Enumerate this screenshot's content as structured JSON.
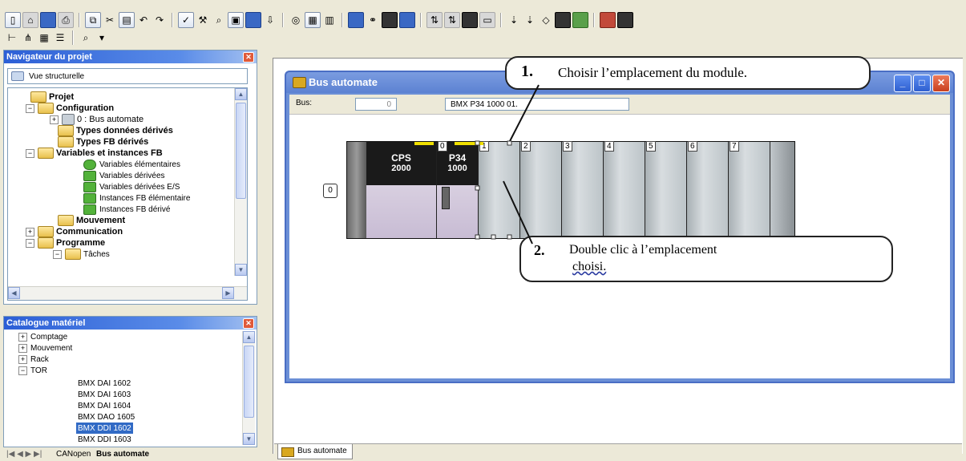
{
  "toolbar": {
    "row1": [
      "new-icon",
      "open-icon",
      "save-icon",
      "print-icon",
      "copy-icon",
      "cut-icon",
      "paste-icon",
      "undo-icon",
      "redo-icon",
      "check-icon",
      "build-icon",
      "search-icon",
      "rebuild-icon",
      "connect-icon",
      "download-icon",
      "animation-icon",
      "library-icon",
      "table-icon",
      "binoculars-icon",
      "screen-icon",
      "monitor-icon",
      "io-icon",
      "io2-icon",
      "rack-icon",
      "module-icon",
      "breakpoint-icon",
      "step-icon",
      "watch-icon",
      "memory-icon",
      "network-icon",
      "window-icon",
      "window2-icon"
    ],
    "row2": [
      "tree-icon",
      "hierarchy-icon",
      "grid-icon",
      "list-icon",
      "zoom-icon",
      "dropdown-icon"
    ]
  },
  "project_nav": {
    "title": "Navigateur du projet",
    "view_label": "Vue structurelle",
    "items": [
      {
        "label": "Projet",
        "bold": true
      },
      {
        "label": "Configuration",
        "bold": true
      },
      {
        "label": "0 : Bus automate",
        "bold": false
      },
      {
        "label": "Types données dérivés",
        "bold": true
      },
      {
        "label": "Types FB dérivés",
        "bold": true
      },
      {
        "label": "Variables et instances FB",
        "bold": true
      },
      {
        "label": "Variables élémentaires",
        "bold": false
      },
      {
        "label": "Variables dérivées",
        "bold": false
      },
      {
        "label": "Variables dérivées E/S",
        "bold": false
      },
      {
        "label": "Instances FB élémentaire",
        "bold": false
      },
      {
        "label": "Instances FB dérivé",
        "bold": false
      },
      {
        "label": "Mouvement",
        "bold": true
      },
      {
        "label": "Communication",
        "bold": true
      },
      {
        "label": "Programme",
        "bold": true
      },
      {
        "label": "Tâches",
        "bold": false
      }
    ]
  },
  "catalog": {
    "title": "Catalogue matériel",
    "items": [
      "Comptage",
      "Mouvement",
      "Rack",
      "TOR",
      "BMX DAI 1602",
      "BMX DAI 1603",
      "BMX DAI 1604",
      "BMX DAO 1605",
      "BMX DDI 1602",
      "BMX DDI 1603"
    ],
    "selected": "BMX DDI 1602"
  },
  "left_tabs": {
    "tab1": "CANopen",
    "tab2": "Bus automate"
  },
  "bus_window": {
    "title": "Bus automate",
    "bus_label": "Bus:",
    "bus_value": "0",
    "cpu_value": "BMX P34 1000  01.",
    "rack_index": "0",
    "modules": [
      {
        "slot": "",
        "name": "CPS",
        "ref": "2000"
      },
      {
        "slot": "0",
        "name": "P34",
        "ref": "1000"
      }
    ],
    "empty_slots": [
      "1",
      "2",
      "3",
      "4",
      "5",
      "6",
      "7"
    ]
  },
  "callouts": {
    "step1_num": "1.",
    "step1_text": "Choisir l’emplacement du module.",
    "step2_num": "2.",
    "step2_text_line1": "Double clic à l’emplacement",
    "step2_text_line2": "choisi."
  },
  "bottom_tab": {
    "label": "Bus automate"
  }
}
